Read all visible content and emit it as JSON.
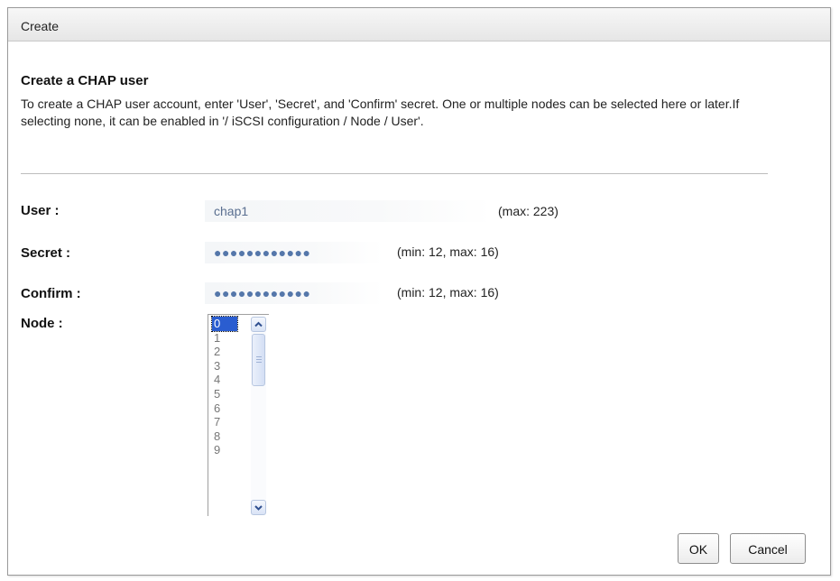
{
  "dialog": {
    "title": "Create",
    "heading": "Create a CHAP user",
    "description": "To create a CHAP user account, enter 'User', 'Secret', and 'Confirm' secret. One or multiple nodes can be selected here or later.If selecting none, it can be enabled in '/ iSCSI configuration / Node / User'."
  },
  "form": {
    "user": {
      "label": "User :",
      "value": "chap1",
      "hint": "(max: 223)"
    },
    "secret": {
      "label": "Secret :",
      "value": "●●●●●●●●●●●●",
      "hint": "(min: 12, max: 16)"
    },
    "confirm": {
      "label": "Confirm :",
      "value": "●●●●●●●●●●●●",
      "hint": "(min: 12, max: 16)"
    },
    "node": {
      "label": "Node :",
      "options": [
        "0",
        "1",
        "2",
        "3",
        "4",
        "5",
        "6",
        "7",
        "8",
        "9"
      ],
      "selected": "0"
    }
  },
  "buttons": {
    "ok": "OK",
    "cancel": "Cancel"
  },
  "icons": {
    "scroll_up": "chevron-up-icon",
    "scroll_down": "chevron-down-icon"
  },
  "colors": {
    "selection": "#2a5dd0",
    "input_text": "#5a6f90"
  }
}
